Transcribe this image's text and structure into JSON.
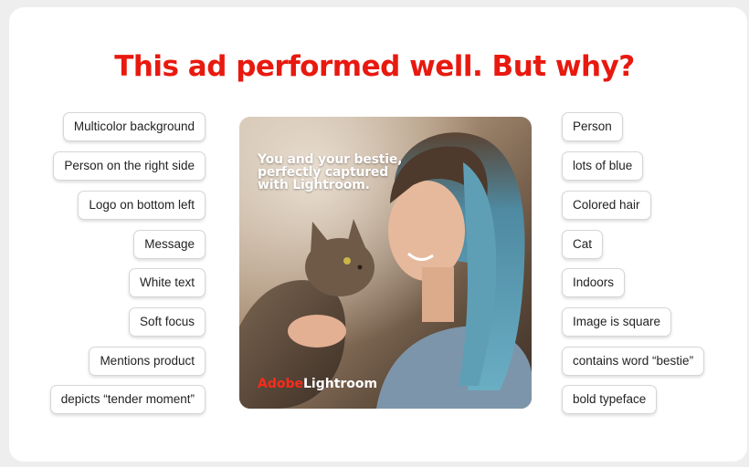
{
  "title": "This ad performed well. But why?",
  "left_tags": [
    "Multicolor background",
    "Person on the right side",
    "Logo on bottom left",
    "Message",
    "White text",
    "Soft focus",
    "Mentions product",
    "depicts “tender moment”"
  ],
  "right_tags": [
    "Person",
    "lots of blue",
    "Colored hair",
    "Cat",
    "Indoors",
    "Image is square",
    "contains word “bestie”",
    "bold typeface"
  ],
  "ad": {
    "message": "You and your bestie, perfectly captured with Lightroom.",
    "logo_brand": "Adobe",
    "logo_product": "Lightroom"
  },
  "colors": {
    "title": "#e8190f",
    "logo_brand": "#ff2a1a",
    "hair": "#5f9fb6"
  }
}
